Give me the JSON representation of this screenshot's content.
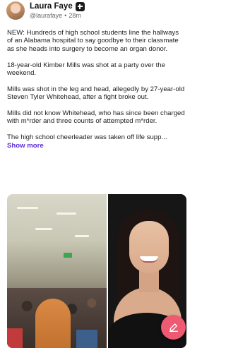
{
  "author": {
    "name": "Laura Faye",
    "handle": "@laurafaye",
    "separator": "•",
    "time": "28m",
    "badge_icon": "plus-badge-icon"
  },
  "post": {
    "paragraphs": [
      "NEW: Hundreds of high school students line the hallways of an Alabama hospital to say goodbye to their classmate as she heads into surgery to become an organ donor.",
      "18-year-old Kimber Mills was shot at a party over the weekend.",
      "Mills was shot in the leg and head, allegedly by 27-year-old Steven Tyler Whitehead, after a fight broke out.",
      "Mills did not know Whitehead, who has since been charged with m*rder and three counts of attempted m*rder.",
      "The high school cheerleader was taken off life supp..."
    ],
    "show_more": "Show more"
  },
  "media": {
    "left_icon": "hospital-crowd-photo",
    "right_icon": "portrait-photo"
  },
  "fab": {
    "icon": "compose-icon",
    "color": "#ef5a73"
  },
  "colors": {
    "accent": "#5b2bd6"
  }
}
